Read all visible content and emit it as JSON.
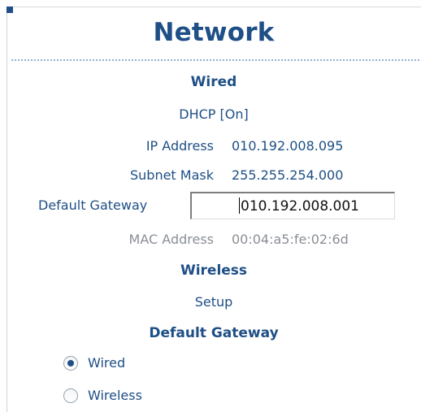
{
  "page": {
    "title": "Network"
  },
  "wired": {
    "heading": "Wired",
    "dhcp": "DHCP [On]",
    "ip_label": "IP Address",
    "ip_value": "010.192.008.095",
    "subnet_label": "Subnet Mask",
    "subnet_value": "255.255.254.000",
    "gateway_label": "Default Gateway",
    "gateway_value": "010.192.008.001",
    "mac_label": "MAC Address",
    "mac_value": "00:04:a5:fe:02:6d"
  },
  "wireless": {
    "heading": "Wireless",
    "setup_link": "Setup"
  },
  "default_gateway": {
    "heading": "Default Gateway",
    "options": [
      {
        "label": "Wired",
        "checked": true
      },
      {
        "label": "Wireless",
        "checked": false
      }
    ]
  },
  "colors": {
    "accent": "#1e4f86",
    "muted": "#8a8f96",
    "separator": "#8fb0d2"
  }
}
